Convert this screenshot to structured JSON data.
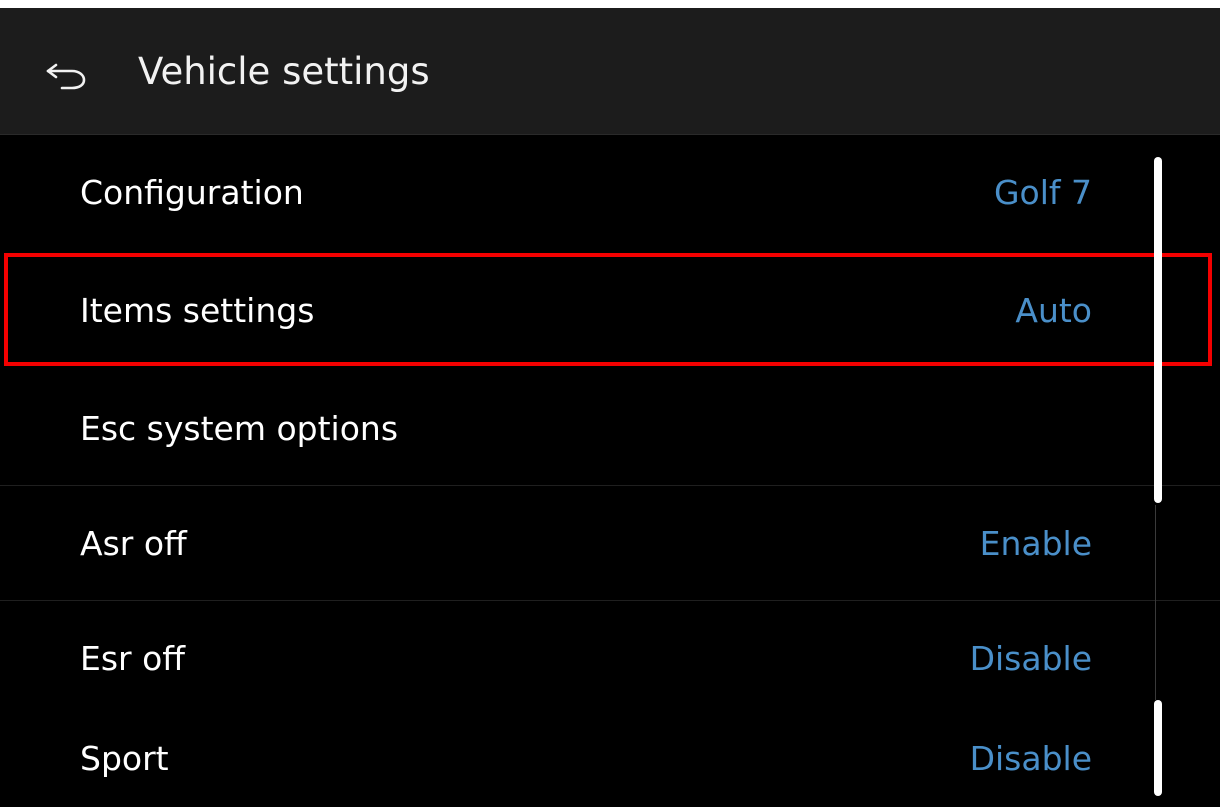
{
  "header": {
    "back_icon": "back-arrow-icon",
    "title": "Vehicle settings"
  },
  "colors": {
    "value_accent": "#4a8fc9",
    "highlight": "#f40000",
    "background": "#000000",
    "header_bg": "#1c1c1c"
  },
  "settings": {
    "items": [
      {
        "label": "Configuration",
        "value": "Golf 7"
      },
      {
        "label": "Items settings",
        "value": "Auto"
      },
      {
        "label": "Esc system options",
        "value": ""
      },
      {
        "label": "Asr off",
        "value": "Enable"
      },
      {
        "label": "Esr off",
        "value": "Disable"
      },
      {
        "label": "Sport",
        "value": "Disable"
      }
    ]
  }
}
